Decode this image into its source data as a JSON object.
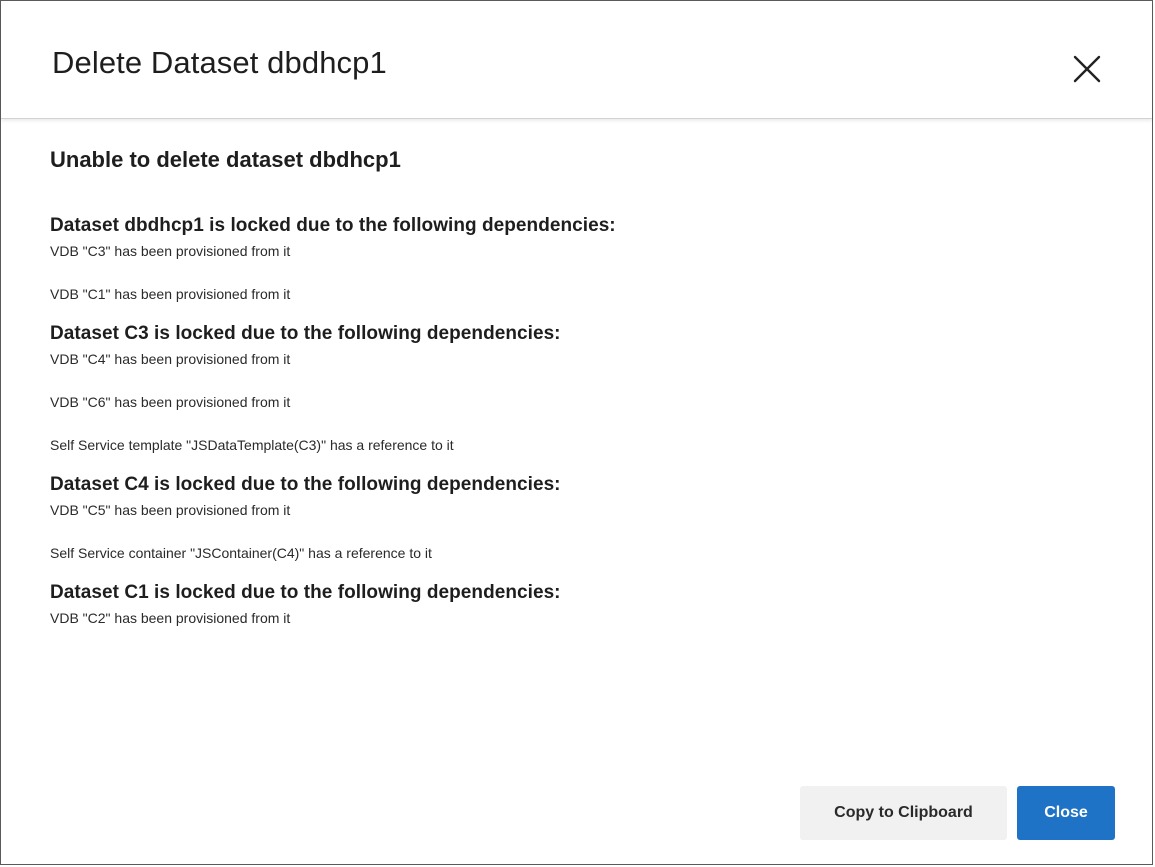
{
  "dialog": {
    "title": "Delete Dataset dbdhcp1",
    "close_icon": "close-icon"
  },
  "message": {
    "heading": "Unable to delete dataset dbdhcp1",
    "groups": [
      {
        "heading": "Dataset dbdhcp1 is locked due to the following dependencies:",
        "items": [
          "VDB \"C3\" has been provisioned from it",
          "VDB \"C1\" has been provisioned from it"
        ]
      },
      {
        "heading": "Dataset C3 is locked due to the following dependencies:",
        "items": [
          "VDB \"C4\" has been provisioned from it",
          "VDB \"C6\" has been provisioned from it",
          "Self Service template \"JSDataTemplate(C3)\" has a reference to it"
        ]
      },
      {
        "heading": "Dataset C4 is locked due to the following dependencies:",
        "items": [
          "VDB \"C5\" has been provisioned from it",
          "Self Service container \"JSContainer(C4)\" has a reference to it"
        ]
      },
      {
        "heading": "Dataset C1 is locked due to the following dependencies:",
        "items": [
          "VDB \"C2\" has been provisioned from it"
        ]
      }
    ]
  },
  "footer": {
    "copy_label": "Copy to Clipboard",
    "close_label": "Close"
  },
  "colors": {
    "primary_button": "#1f73c6",
    "secondary_button": "#f1f1f1",
    "text": "#1e1e1e"
  }
}
